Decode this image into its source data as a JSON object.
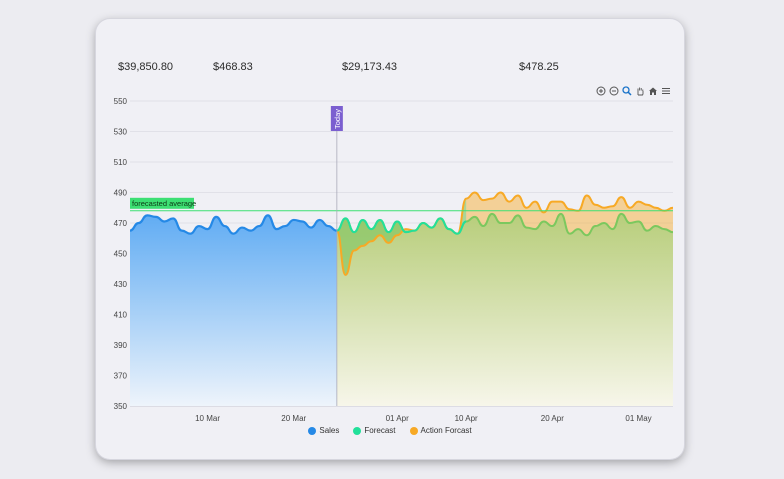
{
  "stats": [
    "$39,850.80",
    "$468.83",
    "$29,173.43",
    "$478.25"
  ],
  "toolbar": [
    "zoom-in-icon",
    "zoom-out-icon",
    "search-icon",
    "hand-icon",
    "home-icon",
    "menu-icon"
  ],
  "colors": {
    "sales": "#2589e6",
    "forecast": "#22e09a",
    "action": "#f7a925",
    "avg_line": "#3ddf73",
    "today": "#7b5fd0"
  },
  "chart_data": {
    "type": "area",
    "ylim": [
      350,
      550
    ],
    "yticks": [
      550,
      530,
      510,
      490,
      470,
      450,
      430,
      410,
      390,
      370,
      350
    ],
    "xticks": [
      {
        "label": "10 Mar",
        "pos": 9
      },
      {
        "label": "20 Mar",
        "pos": 19
      },
      {
        "label": "01 Apr",
        "pos": 31
      },
      {
        "label": "10 Apr",
        "pos": 39
      },
      {
        "label": "20 Apr",
        "pos": 49
      },
      {
        "label": "01 May",
        "pos": 59
      }
    ],
    "x_range": [
      0,
      63
    ],
    "today": {
      "label": "Today",
      "pos": 24
    },
    "average": {
      "label": "forecasted average",
      "value": 478
    },
    "series": [
      {
        "name": "Sales",
        "x": [
          0,
          1,
          2,
          3,
          4,
          5,
          6,
          7,
          8,
          9,
          10,
          11,
          12,
          13,
          14,
          15,
          16,
          17,
          18,
          19,
          20,
          21,
          22,
          23,
          24
        ],
        "values": [
          465,
          470,
          475,
          474,
          471,
          473,
          465,
          463,
          468,
          466,
          474,
          468,
          463,
          467,
          465,
          468,
          475,
          466,
          468,
          472,
          471,
          467,
          472,
          468,
          465
        ]
      },
      {
        "name": "Forecast",
        "x": [
          24,
          25,
          26,
          27,
          28,
          29,
          30,
          31,
          32,
          33,
          34,
          35,
          36,
          37,
          38,
          39,
          40,
          41,
          42,
          43,
          44,
          45,
          46,
          47,
          48,
          49,
          50,
          51,
          52,
          53,
          54,
          55,
          56,
          57,
          58,
          59,
          60,
          61,
          62,
          63
        ],
        "values": [
          465,
          473,
          464,
          472,
          466,
          472,
          464,
          471,
          464,
          465,
          470,
          467,
          473,
          466,
          463,
          471,
          474,
          468,
          476,
          470,
          470,
          475,
          467,
          466,
          471,
          468,
          476,
          463,
          466,
          462,
          468,
          470,
          466,
          476,
          470,
          471,
          465,
          468,
          466,
          464
        ]
      },
      {
        "name": "Action Forcast",
        "x": [
          24,
          25,
          26,
          27,
          28,
          29,
          30,
          31,
          32,
          33,
          34,
          35,
          36,
          37,
          38,
          39,
          40,
          41,
          42,
          43,
          44,
          45,
          46,
          47,
          48,
          49,
          50,
          51,
          52,
          53,
          54,
          55,
          56,
          57,
          58,
          59,
          60,
          61,
          62,
          63
        ],
        "values": [
          465,
          436,
          452,
          455,
          458,
          462,
          457,
          462,
          466,
          465,
          470,
          467,
          473,
          466,
          463,
          486,
          490,
          485,
          486,
          490,
          484,
          488,
          480,
          484,
          477,
          484,
          484,
          479,
          478,
          488,
          482,
          480,
          481,
          487,
          480,
          484,
          482,
          480,
          478,
          480
        ]
      }
    ]
  }
}
